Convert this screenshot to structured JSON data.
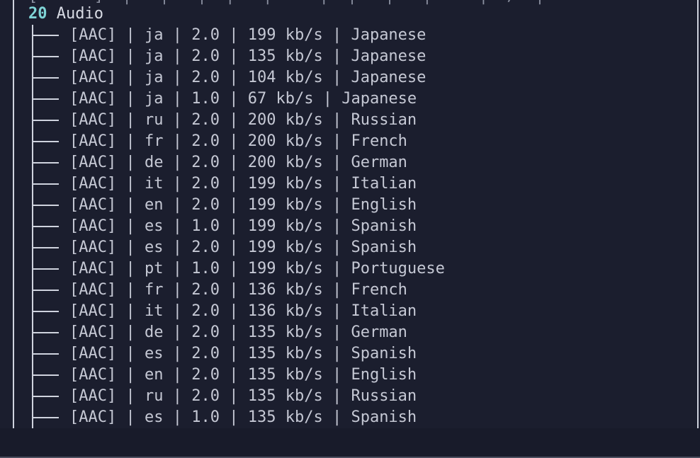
{
  "terminal": {
    "section_count": "20",
    "section_title": "Audio",
    "cut_line": "[      ]  |   |   |  |   |     |  |   |   |     |  /  |"
  },
  "tracks": [
    {
      "codec": "[AAC]",
      "lang": "ja",
      "channels": "2.0",
      "bitrate": "199 kb/s",
      "language_name": "Japanese"
    },
    {
      "codec": "[AAC]",
      "lang": "ja",
      "channels": "2.0",
      "bitrate": "135 kb/s",
      "language_name": "Japanese"
    },
    {
      "codec": "[AAC]",
      "lang": "ja",
      "channels": "2.0",
      "bitrate": "104 kb/s",
      "language_name": "Japanese"
    },
    {
      "codec": "[AAC]",
      "lang": "ja",
      "channels": "1.0",
      "bitrate": "67 kb/s",
      "language_name": "Japanese"
    },
    {
      "codec": "[AAC]",
      "lang": "ru",
      "channels": "2.0",
      "bitrate": "200 kb/s",
      "language_name": "Russian"
    },
    {
      "codec": "[AAC]",
      "lang": "fr",
      "channels": "2.0",
      "bitrate": "200 kb/s",
      "language_name": "French"
    },
    {
      "codec": "[AAC]",
      "lang": "de",
      "channels": "2.0",
      "bitrate": "200 kb/s",
      "language_name": "German"
    },
    {
      "codec": "[AAC]",
      "lang": "it",
      "channels": "2.0",
      "bitrate": "199 kb/s",
      "language_name": "Italian"
    },
    {
      "codec": "[AAC]",
      "lang": "en",
      "channels": "2.0",
      "bitrate": "199 kb/s",
      "language_name": "English"
    },
    {
      "codec": "[AAC]",
      "lang": "es",
      "channels": "1.0",
      "bitrate": "199 kb/s",
      "language_name": "Spanish"
    },
    {
      "codec": "[AAC]",
      "lang": "es",
      "channels": "2.0",
      "bitrate": "199 kb/s",
      "language_name": "Spanish"
    },
    {
      "codec": "[AAC]",
      "lang": "pt",
      "channels": "1.0",
      "bitrate": "199 kb/s",
      "language_name": "Portuguese"
    },
    {
      "codec": "[AAC]",
      "lang": "fr",
      "channels": "2.0",
      "bitrate": "136 kb/s",
      "language_name": "French"
    },
    {
      "codec": "[AAC]",
      "lang": "it",
      "channels": "2.0",
      "bitrate": "136 kb/s",
      "language_name": "Italian"
    },
    {
      "codec": "[AAC]",
      "lang": "de",
      "channels": "2.0",
      "bitrate": "135 kb/s",
      "language_name": "German"
    },
    {
      "codec": "[AAC]",
      "lang": "es",
      "channels": "2.0",
      "bitrate": "135 kb/s",
      "language_name": "Spanish"
    },
    {
      "codec": "[AAC]",
      "lang": "en",
      "channels": "2.0",
      "bitrate": "135 kb/s",
      "language_name": "English"
    },
    {
      "codec": "[AAC]",
      "lang": "ru",
      "channels": "2.0",
      "bitrate": "135 kb/s",
      "language_name": "Russian"
    },
    {
      "codec": "[AAC]",
      "lang": "es",
      "channels": "1.0",
      "bitrate": "135 kb/s",
      "language_name": "Spanish"
    }
  ],
  "colors": {
    "background": "#1b1e2e",
    "text": "#c5c8d4",
    "count_accent": "#7fd4d6",
    "tree_line": "#cfd3de"
  }
}
